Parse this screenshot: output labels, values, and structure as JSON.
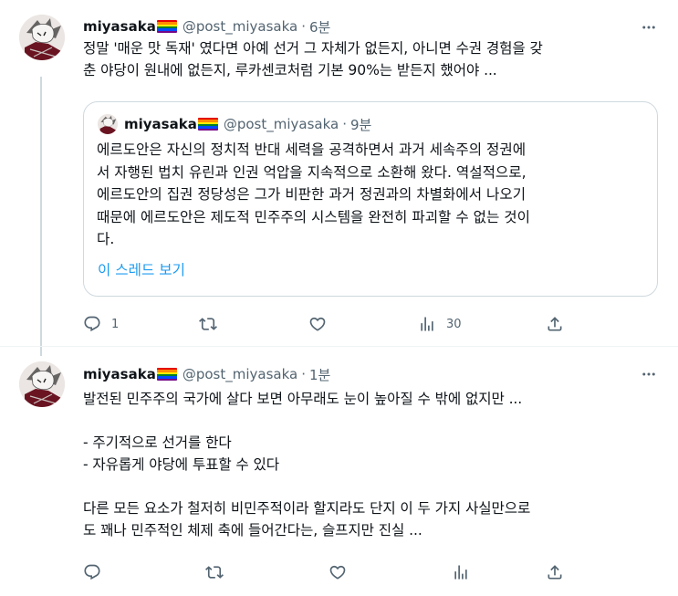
{
  "tweets": [
    {
      "author_name": "miyasaka",
      "author_handle": "@post_miyasaka",
      "separator": "·",
      "time": "6분",
      "text_lines": [
        "정말 '매운 맛 독재' 였다면 아예 선거 그 자체가 없든지, 아니면 수권 경험을 갖",
        "춘 야당이 원내에 없든지, 루카센코처럼 기본 90%는 받든지 했어야 ..."
      ],
      "quoted": {
        "author_name": "miyasaka",
        "author_handle": "@post_miyasaka",
        "separator": "·",
        "time": "9분",
        "text_lines": [
          "에르도안은 자신의 정치적 반대 세력을 공격하면서 과거 세속주의 정권에",
          "서 자행된 법치 유린과 인권 억압을 지속적으로 소환해 왔다. 역설적으로,",
          "에르도안의 집권 정당성은 그가 비판한 과거 정권과의 차별화에서 나오기",
          "때문에 에르도안은 제도적 민주주의 시스템을 완전히 파괴할 수 없는 것이",
          "다."
        ],
        "show_thread": "이 스레드 보기"
      },
      "stats": {
        "replies": "1",
        "retweets": "",
        "likes": "",
        "views": "30"
      }
    },
    {
      "author_name": "miyasaka",
      "author_handle": "@post_miyasaka",
      "separator": "·",
      "time": "1분",
      "text_lines": [
        "발전된 민주주의 국가에 살다 보면 아무래도 눈이 높아질 수 밖에 없지만 ...",
        "",
        "- 주기적으로 선거를 한다",
        "- 자유롭게 야당에 투표할 수 있다",
        "",
        "다른 모든 요소가 철저히 비민주적이라 할지라도 단지 이 두 가지 사실만으로",
        "도 꽤나 민주적인 체제 축에 들어간다는, 슬프지만 진실 ..."
      ],
      "stats": {
        "replies": "",
        "retweets": "",
        "likes": "",
        "views": ""
      }
    }
  ],
  "icons": {
    "reply": "reply-icon",
    "retweet": "retweet-icon",
    "like": "heart-icon",
    "views": "views-icon",
    "share": "share-icon",
    "more": "more-icon",
    "flag": "rainbow-flag-icon"
  },
  "colors": {
    "text": "#0f1419",
    "secondary": "#536471",
    "link": "#1d9bf0",
    "border": "#cfd9de",
    "flag_stripes": [
      "#e40303",
      "#ff8c00",
      "#ffed00",
      "#008026",
      "#004dff",
      "#750787"
    ]
  }
}
